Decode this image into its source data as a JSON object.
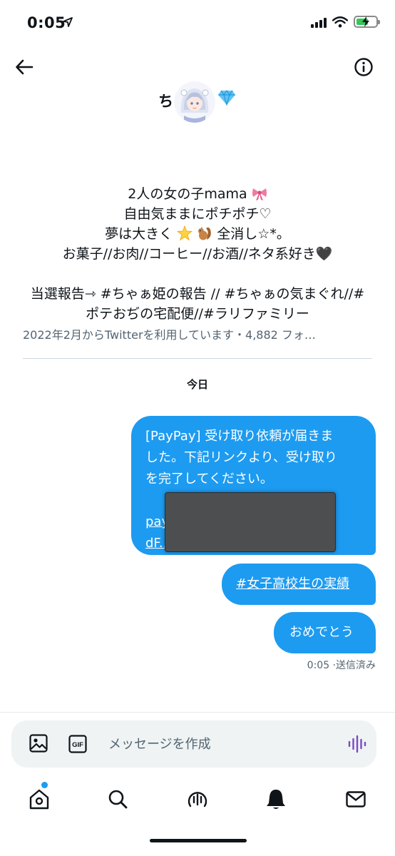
{
  "status_bar": {
    "time": "0:05",
    "battery_percent": 60
  },
  "header": {
    "name_prefix": "ち",
    "avatar": "avatar-image",
    "badge": "gem-emoji"
  },
  "bio": {
    "line1": "2人の女の子mama",
    "line2": "自由気ままにポチポチ♡",
    "line3_a": "夢は大きく",
    "line3_b": "全消し☆*。",
    "line4": "お菓子//お肉//コーヒー//お酒//ネタ系好き🖤",
    "line5": "当選報告⇾ #ちゃぁ姫の報告 // #ちゃぁの気まぐれ//#",
    "line6": "ポテおぢの宅配便//#ラリファミリー"
  },
  "joined": "2022年2月からTwitterを利用しています・4,882 フォ…",
  "date_separator": "今日",
  "messages": [
    {
      "text_1": "[PayPay] 受け取り依頼が届きま",
      "text_2": "した。下記リンクより、受け取り",
      "text_3": "を完了してください。",
      "link_1": "pay",
      "link_2": "dF..."
    },
    {
      "text": "#女子高校生の実績"
    },
    {
      "text": "おめでとう"
    }
  ],
  "message_meta": "0:05 ·送信済み",
  "composer": {
    "placeholder": "メッセージを作成",
    "gif_label": "GIF"
  },
  "colors": {
    "accent": "#1d9bf0",
    "text": "#0f1419",
    "secondary_text": "#536471",
    "composer_bg": "#eff3f4",
    "voice_icon": "#794bc4"
  },
  "tabs": [
    "home-icon",
    "search-icon",
    "spaces-icon",
    "notifications-icon",
    "messages-icon"
  ]
}
